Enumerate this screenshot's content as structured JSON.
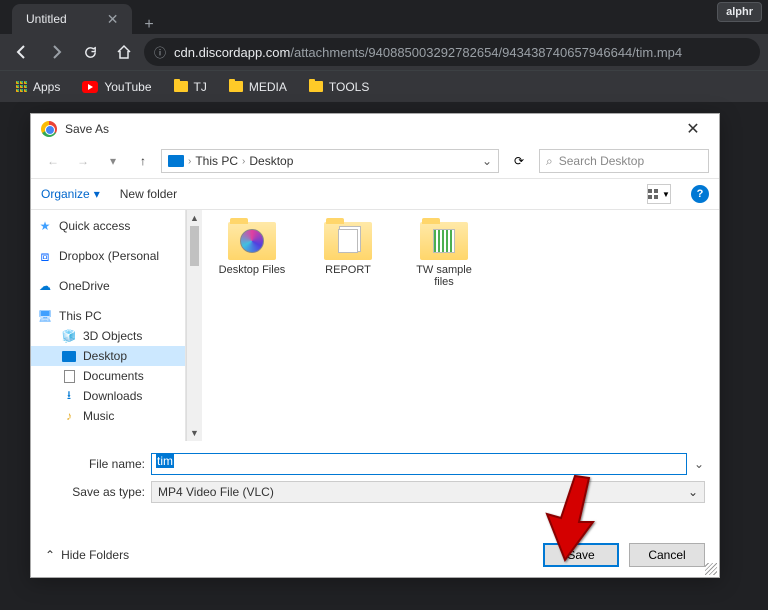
{
  "badge": "alphr",
  "tab": {
    "title": "Untitled"
  },
  "url": {
    "domain": "cdn.discordapp.com",
    "path": "/attachments/940885003292782654/943438740657946644/tim.mp4"
  },
  "bookmarks": {
    "apps": "Apps",
    "items": [
      "YouTube",
      "TJ",
      "MEDIA",
      "TOOLS"
    ]
  },
  "dialog": {
    "title": "Save As",
    "breadcrumb": {
      "root": "This PC",
      "current": "Desktop"
    },
    "search_placeholder": "Search Desktop",
    "toolbar": {
      "organize": "Organize",
      "new_folder": "New folder"
    },
    "sidebar": [
      {
        "label": "Quick access",
        "type": "star"
      },
      {
        "label": "Dropbox (Personal",
        "type": "dropbox"
      },
      {
        "label": "OneDrive",
        "type": "onedrive"
      },
      {
        "label": "This PC",
        "type": "pc"
      },
      {
        "label": "3D Objects",
        "type": "cube",
        "indent": true
      },
      {
        "label": "Desktop",
        "type": "desktop",
        "indent": true,
        "selected": true
      },
      {
        "label": "Documents",
        "type": "doc",
        "indent": true
      },
      {
        "label": "Downloads",
        "type": "dl",
        "indent": true
      },
      {
        "label": "Music",
        "type": "music",
        "indent": true
      }
    ],
    "folders": [
      {
        "name": "Desktop Files",
        "overlay": "disc"
      },
      {
        "name": "REPORT",
        "overlay": "pages"
      },
      {
        "name": "TW sample files",
        "overlay": "stripes"
      }
    ],
    "form": {
      "filename_label": "File name:",
      "filename_value": "tim",
      "type_label": "Save as type:",
      "type_value": "MP4 Video File (VLC)"
    },
    "hide_folders": "Hide Folders",
    "save": "Save",
    "cancel": "Cancel"
  }
}
